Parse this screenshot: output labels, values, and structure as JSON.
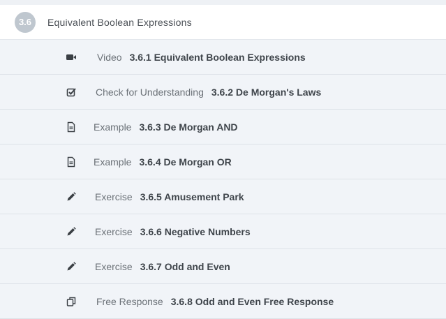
{
  "section": {
    "number": "3.6",
    "title": "Equivalent Boolean Expressions"
  },
  "items": [
    {
      "type": "Video",
      "title": "3.6.1 Equivalent Boolean Expressions",
      "icon": "video-camera-icon"
    },
    {
      "type": "Check for Understanding",
      "title": "3.6.2 De Morgan's Laws",
      "icon": "checkbox-icon"
    },
    {
      "type": "Example",
      "title": "3.6.3 De Morgan AND",
      "icon": "document-icon"
    },
    {
      "type": "Example",
      "title": "3.6.4 De Morgan OR",
      "icon": "document-icon"
    },
    {
      "type": "Exercise",
      "title": "3.6.5 Amusement Park",
      "icon": "pencil-icon"
    },
    {
      "type": "Exercise",
      "title": "3.6.6 Negative Numbers",
      "icon": "pencil-icon"
    },
    {
      "type": "Exercise",
      "title": "3.6.7 Odd and Even",
      "icon": "pencil-icon"
    },
    {
      "type": "Free Response",
      "title": "3.6.8 Odd and Even Free Response",
      "icon": "copy-icon"
    }
  ],
  "colors": {
    "badge": "#bfc7cf",
    "header_bg": "#ffffff",
    "row_bg": "#f1f4f8",
    "icon": "#3a3f44"
  }
}
